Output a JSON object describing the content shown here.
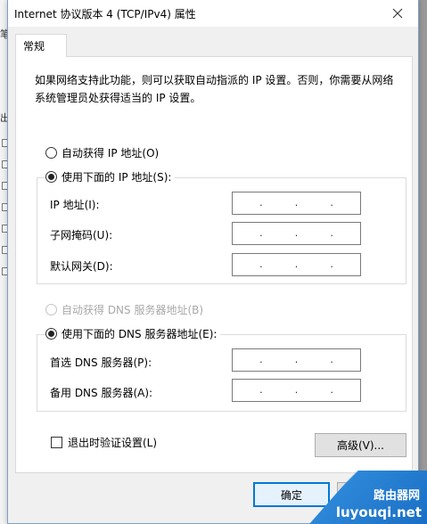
{
  "background": {
    "fragments": [
      "笔",
      "出"
    ]
  },
  "window": {
    "title": "Internet 协议版本 4 (TCP/IPv4) 属性",
    "close_icon": "close-icon"
  },
  "tabs": [
    {
      "label": "常规"
    }
  ],
  "description": "如果网络支持此功能，则可以获取自动指派的 IP 设置。否则，你需要从网络系统管理员处获得适当的 IP 设置。",
  "ip_section": {
    "auto_option": "自动获得 IP 地址(O)",
    "manual_option": "使用下面的 IP 地址(S):",
    "selected": "manual",
    "fields": [
      {
        "label": "IP 地址(I):",
        "value": ". . ."
      },
      {
        "label": "子网掩码(U):",
        "value": ". . ."
      },
      {
        "label": "默认网关(D):",
        "value": ". . ."
      }
    ]
  },
  "dns_section": {
    "auto_option": "自动获得 DNS 服务器地址(B)",
    "auto_disabled": true,
    "manual_option": "使用下面的 DNS 服务器地址(E):",
    "selected": "manual",
    "fields": [
      {
        "label": "首选 DNS 服务器(P):",
        "value": ". . ."
      },
      {
        "label": "备用 DNS 服务器(A):",
        "value": ". . ."
      }
    ]
  },
  "validate_checkbox": {
    "label": "退出时验证设置(L)",
    "checked": false
  },
  "advanced_button": "高级(V)...",
  "ok_button": "确定",
  "cancel_button": "取",
  "watermark": {
    "line1": "路由器网",
    "line2": "luyouqi.net"
  },
  "colors": {
    "accent": "#0078d7",
    "watermark": "#1a6fc4"
  }
}
